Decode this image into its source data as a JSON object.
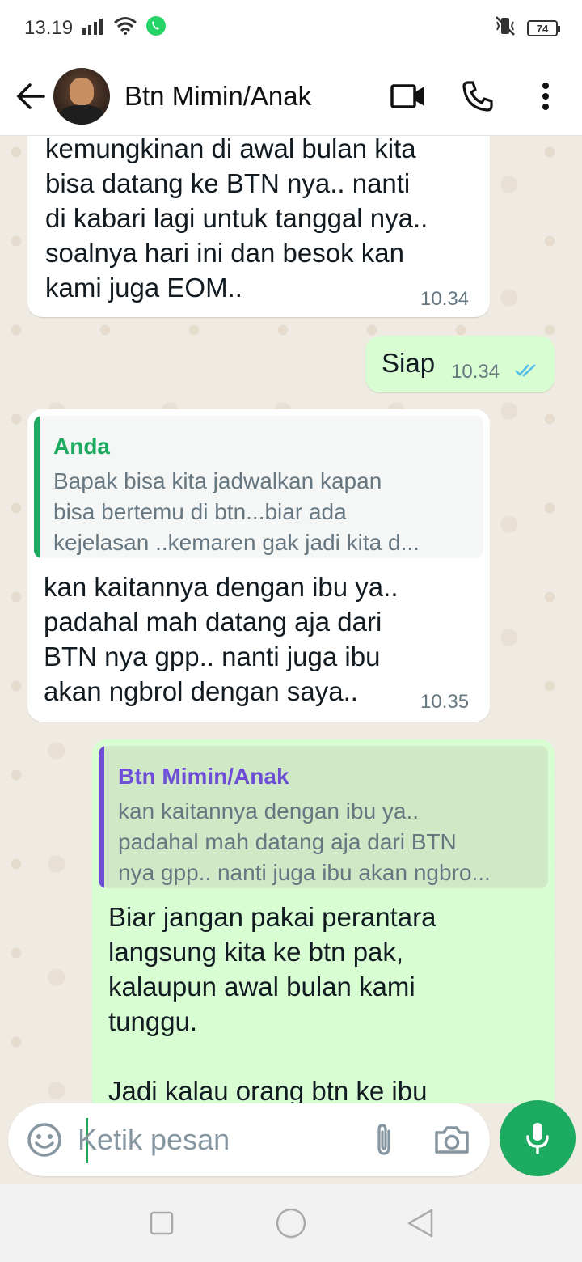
{
  "status_bar": {
    "time": "13.19",
    "battery": "74"
  },
  "header": {
    "contact_name": "Btn Mimin/Anak"
  },
  "messages": {
    "m1": {
      "text": "kemungkinan di awal bulan kita\nbisa datang ke BTN nya.. nanti\ndi kabari lagi untuk tanggal nya..\nsoalnya hari ini dan besok kan\nkami juga EOM..",
      "time": "10.34"
    },
    "m2": {
      "text": "Siap",
      "time": "10.34"
    },
    "m3": {
      "quote_author": "Anda",
      "quote_text": "Bapak bisa kita jadwalkan kapan\nbisa bertemu di btn...biar ada\nkejelasan ..kemaren gak jadi kita d...",
      "text": "kan kaitannya dengan ibu ya..\npadahal mah datang aja dari\nBTN nya gpp.. nanti juga ibu\nakan ngbrol dengan saya..",
      "time": "10.35"
    },
    "m4": {
      "quote_author": "Btn Mimin/Anak",
      "quote_text": "kan kaitannya dengan ibu ya..\npadahal mah datang aja dari BTN\nnya gpp.. nanti juga ibu akan ngbro...",
      "text": "Biar jangan pakai perantara\nlangsung kita ke btn pak,\nkalaupun awal bulan kami\ntunggu.\n\nJadi kalau orang btn ke ibu"
    }
  },
  "input": {
    "placeholder": "Ketik pesan"
  },
  "colors": {
    "accent_green": "#1daa61",
    "read_ticks": "#53bdeb",
    "quote_self": "#1daa61",
    "quote_contact": "#6e4ed6",
    "outgoing_bubble": "#d9fdd3"
  }
}
